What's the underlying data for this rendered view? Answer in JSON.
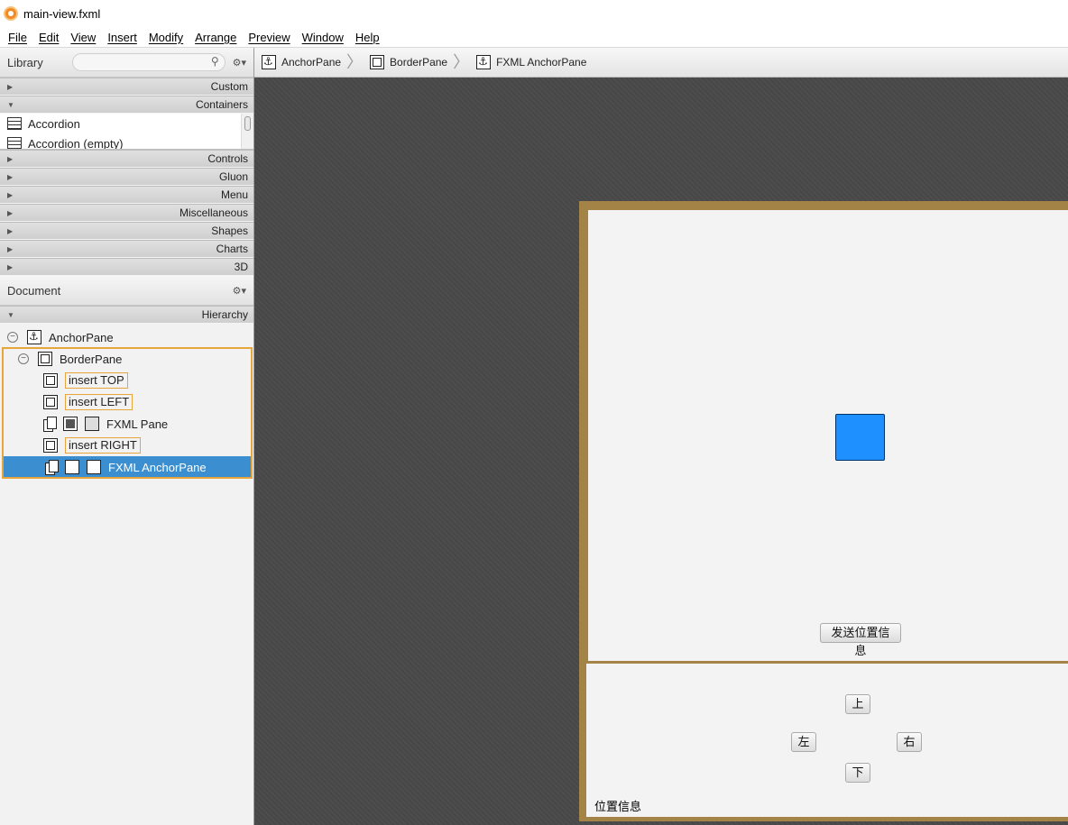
{
  "window": {
    "title": "main-view.fxml"
  },
  "menu": [
    "File",
    "Edit",
    "View",
    "Insert",
    "Modify",
    "Arrange",
    "Preview",
    "Window",
    "Help"
  ],
  "library": {
    "title": "Library",
    "search_placeholder": "",
    "sections_before": [
      "Custom",
      "Containers"
    ],
    "items": [
      "Accordion",
      "Accordion  (empty)"
    ],
    "sections_after": [
      "Controls",
      "Gluon",
      "Menu",
      "Miscellaneous",
      "Shapes",
      "Charts",
      "3D"
    ]
  },
  "document": {
    "title": "Document",
    "section": "Hierarchy",
    "tree": {
      "root": "AnchorPane",
      "border": "BorderPane",
      "insert_top": "insert TOP",
      "insert_left": "insert LEFT",
      "fxml_pane": "FXML Pane",
      "insert_right": "insert RIGHT",
      "fxml_anchor": "FXML AnchorPane"
    }
  },
  "breadcrumb": [
    "AnchorPane",
    "BorderPane",
    "FXML AnchorPane"
  ],
  "canvas": {
    "send_button": "发送位置信息",
    "up": "上",
    "left": "左",
    "right": "右",
    "down": "下",
    "position_label": "位置信息",
    "rect_color": "#1e90ff",
    "frame_color": "#a38446"
  }
}
